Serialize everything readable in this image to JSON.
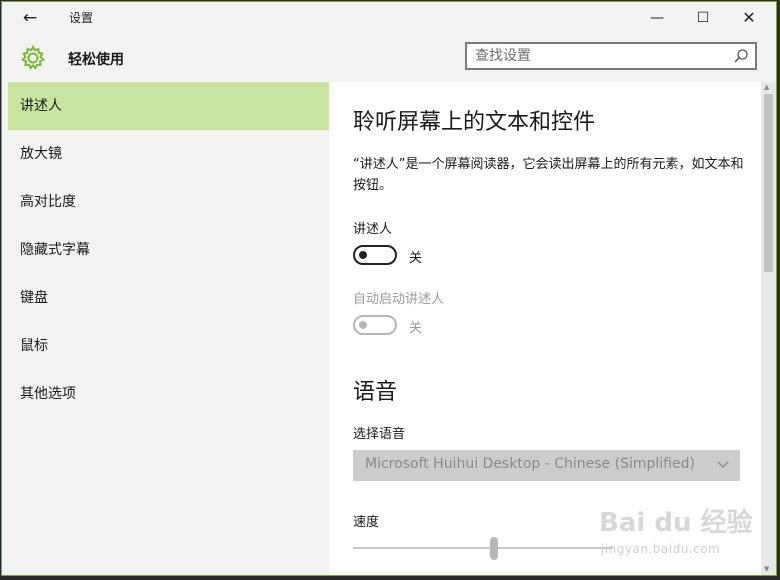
{
  "window": {
    "title": "设置",
    "back_icon": "←",
    "minimize_icon": "—",
    "maximize_icon": "☐",
    "close_icon": "✕"
  },
  "header": {
    "title": "轻松使用",
    "search_placeholder": "查找设置"
  },
  "sidebar": {
    "items": [
      {
        "label": "讲述人",
        "selected": true
      },
      {
        "label": "放大镜"
      },
      {
        "label": "高对比度"
      },
      {
        "label": "隐藏式字幕"
      },
      {
        "label": "键盘"
      },
      {
        "label": "鼠标"
      },
      {
        "label": "其他选项"
      }
    ]
  },
  "content": {
    "section1_title": "聆听屏幕上的文本和控件",
    "description": "“讲述人”是一个屏幕阅读器，它会读出屏幕上的所有元素，如文本和按钮。",
    "narrator_label": "讲述人",
    "narrator_state": "关",
    "autostart_label": "自动启动讲述人",
    "autostart_state": "关",
    "section2_title": "语音",
    "voice_label": "选择语音",
    "voice_value": "Microsoft Huihui Desktop - Chinese (Simplified)",
    "speed_label": "速度"
  },
  "watermark": {
    "brand": "Bai du 经验",
    "url": "jingyan.baidu.com"
  },
  "colors": {
    "accent": "#7ab83a",
    "selected_bg": "#c9e3a0"
  }
}
